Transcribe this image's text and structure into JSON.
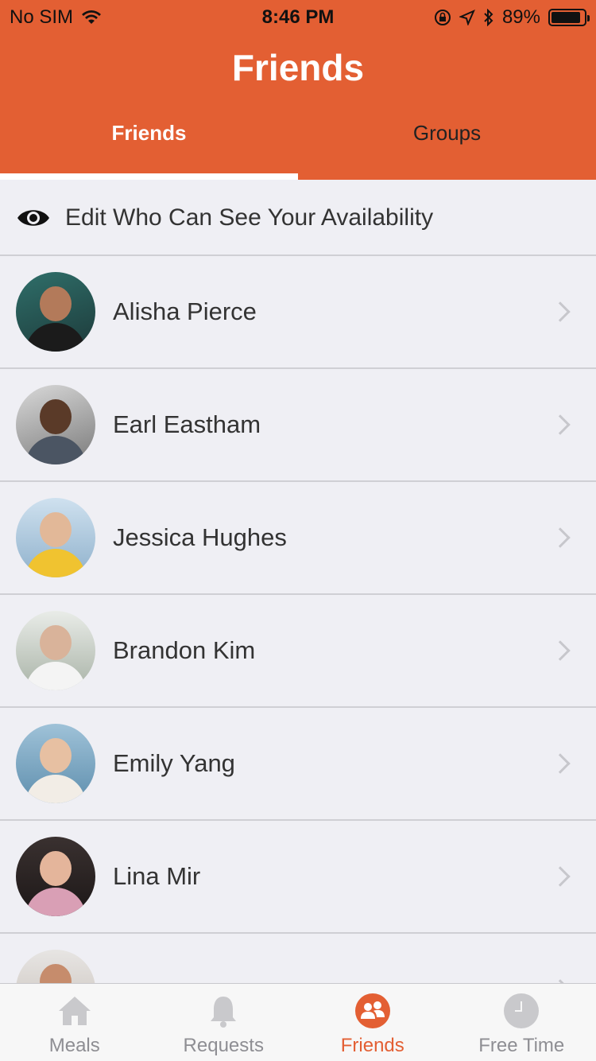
{
  "status_bar": {
    "carrier": "No SIM",
    "time": "8:46 PM",
    "battery_percent": "89%",
    "battery_level": 0.89
  },
  "header": {
    "title": "Friends",
    "tabs": [
      {
        "label": "Friends",
        "active": true
      },
      {
        "label": "Groups",
        "active": false
      }
    ]
  },
  "availability": {
    "label": "Edit Who Can See Your Availability",
    "icon": "eye-icon"
  },
  "friends": [
    {
      "name": "Alisha Pierce"
    },
    {
      "name": "Earl Eastham"
    },
    {
      "name": "Jessica Hughes"
    },
    {
      "name": "Brandon Kim"
    },
    {
      "name": "Emily Yang"
    },
    {
      "name": "Lina Mir"
    }
  ],
  "tabbar": {
    "items": [
      {
        "label": "Meals",
        "icon": "house-icon"
      },
      {
        "label": "Requests",
        "icon": "bell-icon"
      },
      {
        "label": "Friends",
        "icon": "friends-icon",
        "active": true
      },
      {
        "label": "Free Time",
        "icon": "clock-icon"
      }
    ]
  },
  "colors": {
    "accent": "#e35f33",
    "background": "#efeff4",
    "inactive": "#8e8e93"
  }
}
